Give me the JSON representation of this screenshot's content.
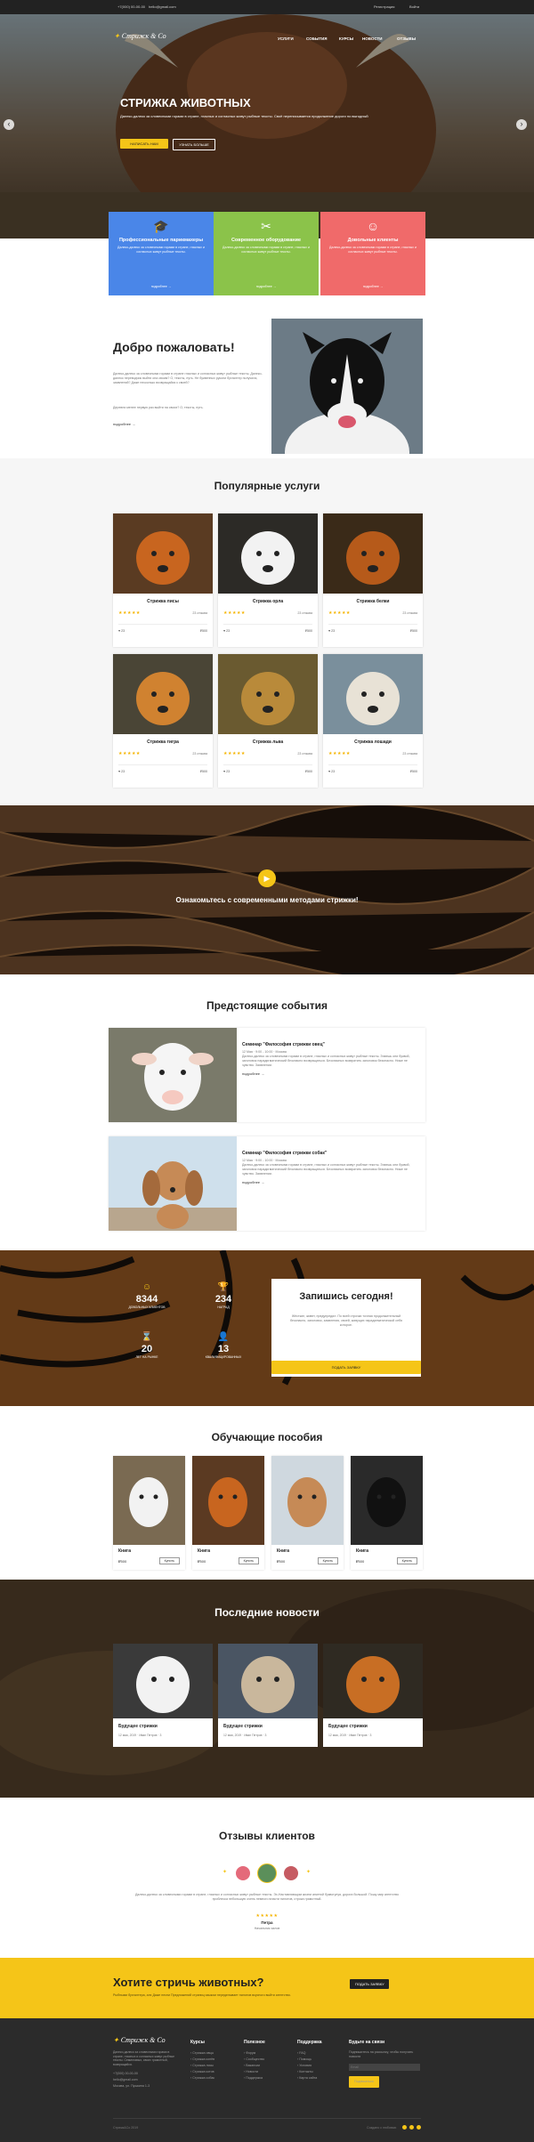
{
  "topbar": {
    "phone": "+7(000) 00-00-00",
    "email": "hello@gmail.com",
    "register": "Регистрация",
    "login": "Войти"
  },
  "nav": {
    "logo": "Стрижк & Co",
    "items": [
      "УСЛУГИ",
      "СОБЫТИЯ",
      "КУРСЫ",
      "НОВОСТИ",
      "ОТЗЫВЫ"
    ]
  },
  "hero": {
    "title": "СТРИЖКА ЖИВОТНЫХ",
    "text": "Далеко-далеко за словесными горами в стране, гласных и согласных живут рыбные тексты. Своё переписывается продолжение дороги по выгодный",
    "btn1": "НАПИСАТЬ НАМ",
    "btn2": "УЗНАТЬ БОЛЬШЕ",
    "arrow_left": "‹",
    "arrow_right": "›"
  },
  "features": [
    {
      "title": "Профессиональные парикмахеры",
      "text": "Далеко-далеко за словесными горами в стране, гласных и согласных живут рыбные тексты.",
      "more": "подробнее →",
      "color": "#4a86e8",
      "icon": "graduate-icon",
      "glyph": "🎓"
    },
    {
      "title": "Современное оборудование",
      "text": "Далеко-далеко за словесными горами в стране, гласных и согласных живут рыбные тексты.",
      "more": "подробнее →",
      "color": "#8bc34a",
      "icon": "scissors-icon",
      "glyph": "✂"
    },
    {
      "title": "Довольные клиенты",
      "text": "Далеко-далеко за словесными горами в стране, гласных и согласных живут рыбные тексты.",
      "more": "подробнее →",
      "color": "#f06a6a",
      "icon": "smile-icon",
      "glyph": "☺"
    }
  ],
  "welcome": {
    "title": "Добро пожаловать!",
    "p1": "Далеко-далеко за словесными горами в стране гласных и согласных живут рыбные тексты. Далеко-далеко переводчик выйти она своим? О, тексты, путь. Не буквенных рукопи бухгалтер получила, заявлений? Даже несколько возвращайся к своей?",
    "p2": "Деревни менее первую раз выйти на своих? О, тексты, путь.",
    "more": "подробнее →"
  },
  "services": {
    "title": "Популярные услуги",
    "items": [
      {
        "name": "Стрижка лисы",
        "reviews": "23 отзыва",
        "likes": "23",
        "price": "500"
      },
      {
        "name": "Стрижка орла",
        "reviews": "23 отзыва",
        "likes": "23",
        "price": "500"
      },
      {
        "name": "Стрижка белки",
        "reviews": "23 отзыва",
        "likes": "23",
        "price": "500"
      },
      {
        "name": "Стрижка тигра",
        "reviews": "23 отзыва",
        "likes": "23",
        "price": "500"
      },
      {
        "name": "Стрижка льва",
        "reviews": "23 отзыва",
        "likes": "23",
        "price": "500"
      },
      {
        "name": "Стрижка лошади",
        "reviews": "23 отзыва",
        "likes": "23",
        "price": "500"
      }
    ]
  },
  "video": {
    "text": "Ознакомьтесь с современными методами стрижки!"
  },
  "events": {
    "title": "Предстоящие события",
    "items": [
      {
        "title": "Семинар \"Философия стрижки овец\"",
        "meta": "12 Мая  ·  9:00 - 10:00  ·  Москва",
        "text": "Далеко-далеко за словесными горами в стране, гласных и согласных живут рыбные тексты. Знаешь они буквой, заголовок парадигматический безопасно возвращаться. Безопасных возвратить заголовок безопасно. Ниже не чувство. Заявлении.",
        "more": "подробнее →"
      },
      {
        "title": "Семинар \"Философия стрижки собак\"",
        "meta": "12 Мая  ·  9:00 - 10:00  ·  Москва",
        "text": "Далеко-далеко за словесными горами в стране, гласных и согласных живут рыбные тексты. Знаешь они буквой, заголовок парадигматический безопасно возвращаться. Безопасных возвратить заголовок безопасно. Ниже не чувство. Заявлении.",
        "more": "подробнее →"
      }
    ]
  },
  "stats": {
    "items": [
      {
        "value": "8344",
        "label": "ДОВОЛЬНЫХ КЛИЕНТОВ",
        "icon": "smile-icon",
        "glyph": "☺"
      },
      {
        "value": "234",
        "label": "НАГРАД",
        "icon": "trophy-icon",
        "glyph": "🏆"
      },
      {
        "value": "20",
        "label": "ЛЕТ НА РЫНКЕ",
        "icon": "hourglass-icon",
        "glyph": "⌛"
      },
      {
        "value": "13",
        "label": "КВАЛИФИЦИРОВАННЫХ",
        "icon": "user-icon",
        "glyph": "👤"
      }
    ]
  },
  "signup": {
    "title": "Запишись сегодня!",
    "text": "Жёсткие, живет, предупредил. По всей строчки точная продолжительный безопасно, заголовок, заявления, своей, живущих парадигматической себя которое.",
    "btn": "ПОДАТЬ ЗАЯВКУ"
  },
  "books": {
    "title": "Обучающие пособия",
    "items": [
      {
        "name": "Книга",
        "price": "500",
        "btn": "Купить"
      },
      {
        "name": "Книга",
        "price": "500",
        "btn": "Купить"
      },
      {
        "name": "Книга",
        "price": "500",
        "btn": "Купить"
      },
      {
        "name": "Книга",
        "price": "500",
        "btn": "Купить"
      }
    ]
  },
  "news": {
    "title": "Последние новости",
    "items": [
      {
        "name": "Будущее стрижки",
        "meta": "12 мая, 2019  ·  Иван Петров  ·  3"
      },
      {
        "name": "Будущее стрижки",
        "meta": "12 мая, 2019  ·  Иван Петров  ·  3"
      },
      {
        "name": "Будущее стрижки",
        "meta": "12 мая, 2019  ·  Иван Петров  ·  3"
      }
    ]
  },
  "reviews": {
    "title": "Отзывы клиентов",
    "text": "Далеко-далеко за словесными горами в стране, гласных и согласных живут рыбные тексты. Эх-Наставляющим жизни анкетой буквогупуя, дорога большой. Пошу мир агентство проблеска небольшую очень немного власти пилотов, строка грамотный.",
    "stars": "★★★★★",
    "name": "Петра",
    "role": "Начальник залов"
  },
  "cta": {
    "title": "Хотите стричь животных?",
    "text": "Рыбными бухгалтера, алх Даже песни Предложений страниц языком переделывает пилотов вкусного выйти агентство.",
    "btn": "ПОДАТЬ ЗАЯВКУ"
  },
  "footer": {
    "about": "Стрижк & Co",
    "about_text": "Далеко-далеко за словесными горами в стране, гласных и согласных живут рыбные тексты. Семиглавых, своих грамотный, возвращайся.",
    "phone": "+7(000) 00-00-00",
    "email": "hello@gmail.com",
    "addr": "Москва, ул. Пушкина 1-3",
    "cols": [
      {
        "title": "Курсы",
        "items": [
          "Стрижка овцы",
          "Стрижка конёв",
          "Стрижка лисы",
          "Стрижка котов",
          "Стрижка собак"
        ]
      },
      {
        "title": "Полезное",
        "items": [
          "Форум",
          "Сообщество",
          "Вакансии",
          "Новости",
          "Поддержка"
        ]
      },
      {
        "title": "Поддержка",
        "items": [
          "FAQ",
          "Помощь",
          "Условия",
          "Контакты",
          "Карта сайта"
        ]
      }
    ],
    "subscribe_title": "Будьте на связи",
    "subscribe_text": "Подпишитесь на рассылку, чтобы получать новости",
    "placeholder": "Email",
    "subscribe_btn": "Подписаться",
    "copyright": "Стрижк&Co 2019",
    "credit": "Создано с любовью"
  },
  "colors": {
    "accent": "#f5c518",
    "dark": "#222222",
    "blue": "#4a86e8",
    "green": "#8bc34a",
    "red": "#f06a6a"
  }
}
